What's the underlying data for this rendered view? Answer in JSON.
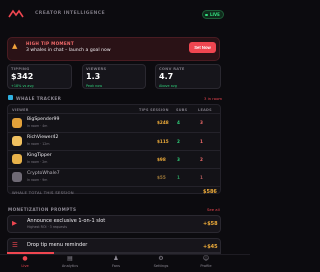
{
  "header": {
    "brand": "CREATOR INTELLIGENCE",
    "live_label": "LIVE"
  },
  "alert": {
    "title": "HIGH TIP MOMENT",
    "subtitle": "3 whales in chat – launch a goal now",
    "button": "Set Now"
  },
  "stats": [
    {
      "label": "TIPPING",
      "value": "$342",
      "sub": "+18% vs avg"
    },
    {
      "label": "VIEWERS",
      "value": "1.3",
      "sub": "Peak now"
    },
    {
      "label": "CONV RATE",
      "value": "4.7",
      "sub": "Above avg"
    }
  ],
  "whale_tracker": {
    "title": "WHALE TRACKER",
    "link": "3 in room",
    "columns": [
      "VIEWER",
      "TIPS SESSION",
      "SUBS",
      "LEADS"
    ],
    "rows": [
      {
        "name": "BigSpender99",
        "meta": "In room · 4m",
        "tips": "$248",
        "subs": "4",
        "leads": "3",
        "avatar_color": "#e2a13a"
      },
      {
        "name": "RichViewer42",
        "meta": "In room · 12m",
        "tips": "$115",
        "subs": "2",
        "leads": "1",
        "avatar_color": "#f0c060"
      },
      {
        "name": "KingTipper",
        "meta": "In room · 2m",
        "tips": "$98",
        "subs": "3",
        "leads": "2",
        "avatar_color": "#e8b24a"
      },
      {
        "name": "CryptoWhale7",
        "meta": "In room · 9m",
        "tips": "$55",
        "subs": "1",
        "leads": "1",
        "avatar_color": "#6f6a75"
      }
    ],
    "total_label": "WHALE TOTAL THIS SESSION",
    "total_value": "$586"
  },
  "monetization": {
    "title": "MONETIZATION PROMPTS",
    "link": "See all",
    "items": [
      {
        "icon": "megaphone-icon",
        "title": "Announce exclusive 1-on-1 slot",
        "sub": "Highest ROI · 3 requests",
        "value": "+$58"
      },
      {
        "icon": "menu-icon",
        "title": "Drop tip menu reminder",
        "sub": "",
        "value": "+$45"
      }
    ]
  },
  "progress": {
    "fraction": 0.22,
    "color": "#ef4650"
  },
  "nav": {
    "items": [
      {
        "label": "Live",
        "icon": "live-icon",
        "color": "#ef4650"
      },
      {
        "label": "Analytics",
        "icon": "analytics-icon",
        "color": "#8e8a95"
      },
      {
        "label": "Fans",
        "icon": "fans-icon",
        "color": "#8e8a95"
      },
      {
        "label": "Settings",
        "icon": "settings-icon",
        "color": "#8e8a95"
      },
      {
        "label": "Profile",
        "icon": "profile-icon",
        "color": "#8e8a95"
      }
    ]
  }
}
